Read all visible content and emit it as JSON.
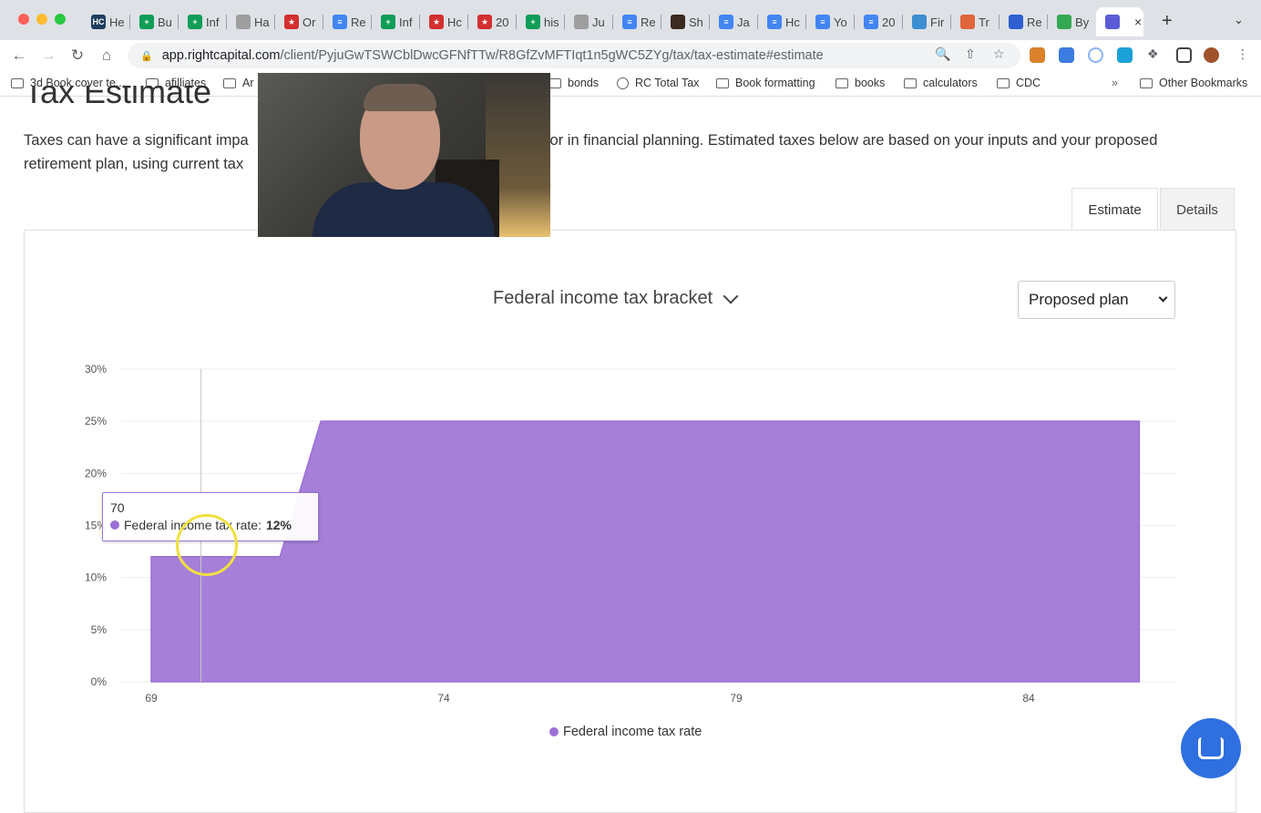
{
  "browser": {
    "tabs": [
      {
        "label": "He",
        "color": "#1f3d5c",
        "glyph": "HC"
      },
      {
        "label": "Bu",
        "color": "#0f9d58",
        "glyph": "+"
      },
      {
        "label": "Inf",
        "color": "#0f9d58",
        "glyph": "+"
      },
      {
        "label": "Ha",
        "color": "#9e9e9e",
        "glyph": ""
      },
      {
        "label": "Or",
        "color": "#d32f2f",
        "glyph": "★"
      },
      {
        "label": "Re",
        "color": "#4285f4",
        "glyph": "≡"
      },
      {
        "label": "Inf",
        "color": "#0f9d58",
        "glyph": "+"
      },
      {
        "label": "Hc",
        "color": "#d32f2f",
        "glyph": "★"
      },
      {
        "label": "20",
        "color": "#d32f2f",
        "glyph": "★"
      },
      {
        "label": "his",
        "color": "#0f9d58",
        "glyph": "+"
      },
      {
        "label": "Ju",
        "color": "#9e9e9e",
        "glyph": ""
      },
      {
        "label": "Re",
        "color": "#4285f4",
        "glyph": "≡"
      },
      {
        "label": "Sh",
        "color": "#3b2a1e",
        "glyph": ""
      },
      {
        "label": "Ja",
        "color": "#4285f4",
        "glyph": "≡"
      },
      {
        "label": "Hc",
        "color": "#4285f4",
        "glyph": "≡"
      },
      {
        "label": "Yo",
        "color": "#4285f4",
        "glyph": "≡"
      },
      {
        "label": "20",
        "color": "#4285f4",
        "glyph": "≡"
      },
      {
        "label": "Fir",
        "color": "#3b8ed0",
        "glyph": ""
      },
      {
        "label": "Tr",
        "color": "#e0653a",
        "glyph": ""
      },
      {
        "label": "Re",
        "color": "#2f5fd0",
        "glyph": ""
      },
      {
        "label": "By",
        "color": "#34a853",
        "glyph": ""
      },
      {
        "label": "",
        "color": "#5b5bd6",
        "glyph": ""
      }
    ],
    "url_host": "app.rightcapital.com",
    "url_path": "/client/PyjuGwTSWCblDwcGFNfTTw/R8GfZvMFTIqt1n5gWC5ZYg/tax/tax-estimate#estimate",
    "bookmarks": [
      {
        "label": "3d Book cover te...",
        "icon": "folder-icon"
      },
      {
        "label": "afilliates",
        "icon": "folder-icon"
      },
      {
        "label": "Ar",
        "icon": "folder-icon"
      },
      {
        "label": "bonds",
        "icon": "folder-icon"
      },
      {
        "label": "RC Total Tax",
        "icon": "globe-icon"
      },
      {
        "label": "Book formatting",
        "icon": "folder-icon"
      },
      {
        "label": "books",
        "icon": "folder-icon"
      },
      {
        "label": "calculators",
        "icon": "folder-icon"
      },
      {
        "label": "CDC",
        "icon": "folder-icon"
      }
    ],
    "bookmarks_overflow": "»",
    "other_bookmarks": "Other Bookmarks"
  },
  "page": {
    "title": "Tax Estimate",
    "intro_line1_start": "Taxes can have a significant impa",
    "intro_line1_end": "ctor in financial planning. Estimated taxes below are based on your inputs and your proposed",
    "intro_line2": "retirement plan, using current tax",
    "tabs": {
      "estimate": "Estimate",
      "details": "Details"
    },
    "chart_selector": "Federal income tax bracket",
    "plan_select": "Proposed plan",
    "legend": "Federal income tax rate",
    "tooltip": {
      "x": "70",
      "label": "Federal income tax rate:",
      "value": "12%"
    }
  },
  "colors": {
    "series": "#9c6fd6",
    "series_fill": "#a57fd8",
    "accent_blue": "#2f6fe0"
  },
  "chart_data": {
    "type": "area",
    "title": "Federal income tax bracket",
    "xlabel": "",
    "ylabel": "",
    "ylim": [
      0,
      30
    ],
    "xlim": [
      69,
      86
    ],
    "x_ticks": [
      "69",
      "74",
      "79",
      "84"
    ],
    "y_ticks": [
      "0%",
      "5%",
      "10%",
      "15%",
      "20%",
      "25%",
      "30%"
    ],
    "series": [
      {
        "name": "Federal income tax rate",
        "x": [
          69,
          70,
          71,
          72,
          73,
          74,
          75,
          76,
          77,
          78,
          79,
          80,
          81,
          82,
          83,
          84,
          85,
          86
        ],
        "values": [
          12,
          12,
          12,
          25,
          25,
          25,
          25,
          25,
          25,
          25,
          25,
          25,
          25,
          25,
          25,
          25,
          25,
          25
        ]
      }
    ],
    "legend_position": "bottom",
    "grid": true
  }
}
